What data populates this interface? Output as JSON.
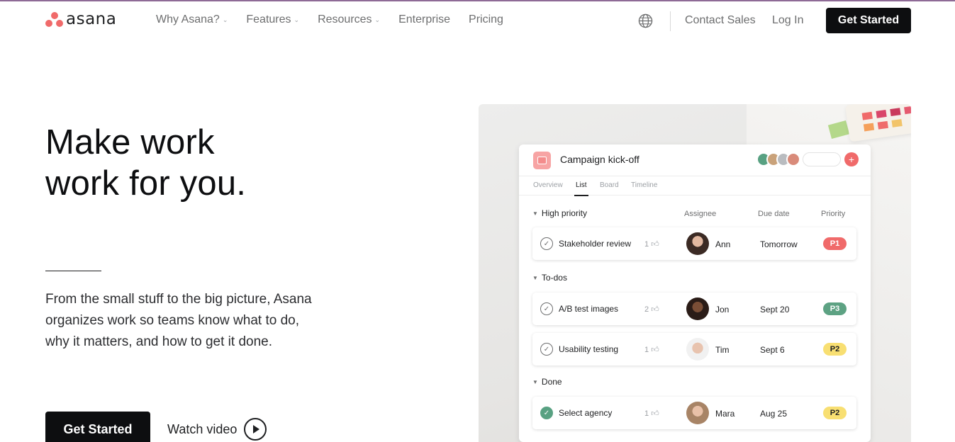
{
  "brand": {
    "name": "asana"
  },
  "nav": {
    "links": [
      {
        "label": "Why Asana?",
        "dropdown": true
      },
      {
        "label": "Features",
        "dropdown": true
      },
      {
        "label": "Resources",
        "dropdown": true
      },
      {
        "label": "Enterprise",
        "dropdown": false
      },
      {
        "label": "Pricing",
        "dropdown": false
      }
    ],
    "contact": "Contact Sales",
    "login": "Log In",
    "cta": "Get Started"
  },
  "hero": {
    "headline_line1": "Make work",
    "headline_line2": "work for you.",
    "description": "From the small stuff to the big picture, Asana organizes work so teams know what to do, why it matters, and how to get it done.",
    "cta": "Get Started",
    "watch": "Watch video"
  },
  "project": {
    "title": "Campaign kick-off",
    "tabs": [
      "Overview",
      "List",
      "Board",
      "Timeline"
    ],
    "active_tab": "List",
    "columns": {
      "assignee": "Assignee",
      "due": "Due date",
      "priority": "Priority"
    },
    "sections": [
      {
        "name": "High priority",
        "tasks": [
          {
            "name": "Stakeholder review",
            "likes": "1",
            "assignee": "Ann",
            "due": "Tomorrow",
            "priority": "P1",
            "done": false
          }
        ]
      },
      {
        "name": "To-dos",
        "tasks": [
          {
            "name": "A/B test images",
            "likes": "2",
            "assignee": "Jon",
            "due": "Sept 20",
            "priority": "P3",
            "done": false
          },
          {
            "name": "Usability testing",
            "likes": "1",
            "assignee": "Tim",
            "due": "Sept 6",
            "priority": "P2",
            "done": false
          }
        ]
      },
      {
        "name": "Done",
        "tasks": [
          {
            "name": "Select agency",
            "likes": "1",
            "assignee": "Mara",
            "due": "Aug 25",
            "priority": "P2",
            "done": true
          }
        ]
      }
    ]
  },
  "colors": {
    "brand": "#f06a6a",
    "dark": "#0d0e10",
    "p1": "#f06a6a",
    "p2": "#f8df72",
    "p3": "#5da283",
    "done": "#58a182"
  },
  "icons": {
    "globe": "globe-icon",
    "play": "play-icon",
    "check": "check-circle-icon",
    "like": "thumbs-up-icon",
    "chevron": "chevron-down-icon"
  }
}
